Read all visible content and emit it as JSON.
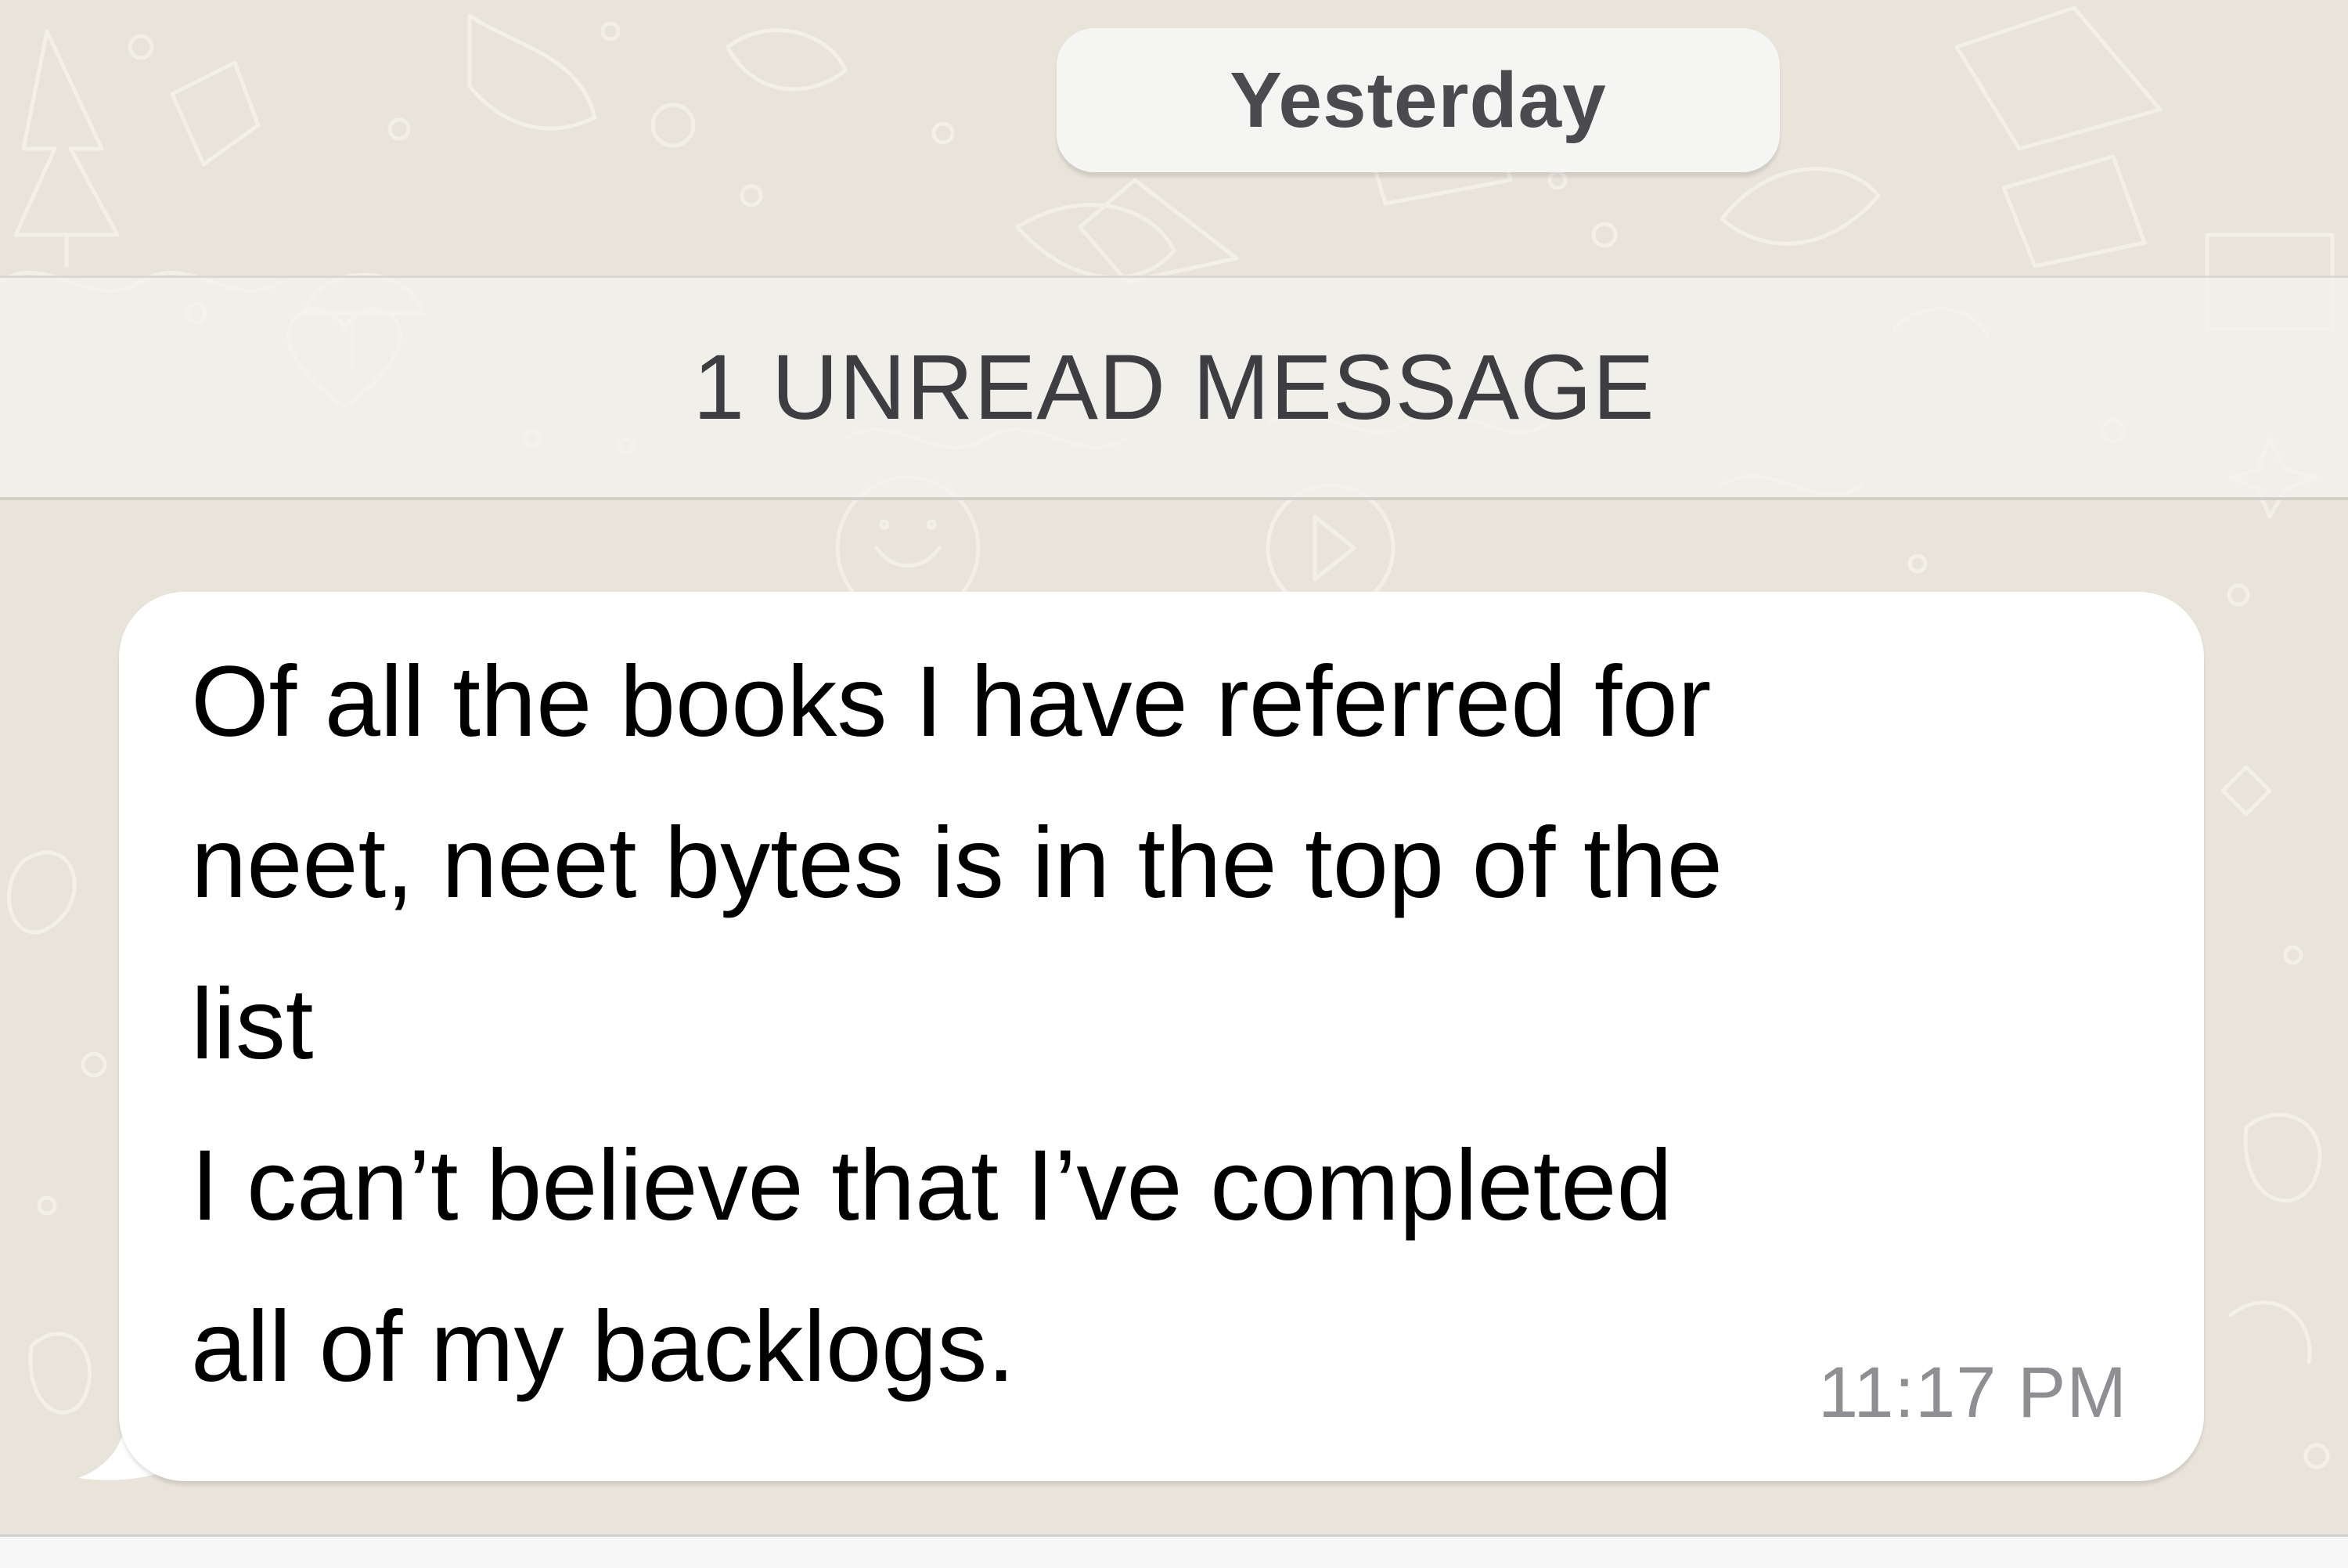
{
  "chat": {
    "background_color": "#E9E4DA",
    "date_divider": {
      "label": "Yesterday"
    },
    "unread_banner": {
      "label": "1 UNREAD MESSAGE"
    },
    "message": {
      "direction": "incoming",
      "lines": [
        "Of all the books I have referred for",
        "neet, neet bytes is in the top of the",
        "list",
        "I can’t believe that I’ve completed",
        "all of my backlogs."
      ],
      "time": "11:17 PM",
      "bubble_color": "#FFFFFF"
    }
  }
}
